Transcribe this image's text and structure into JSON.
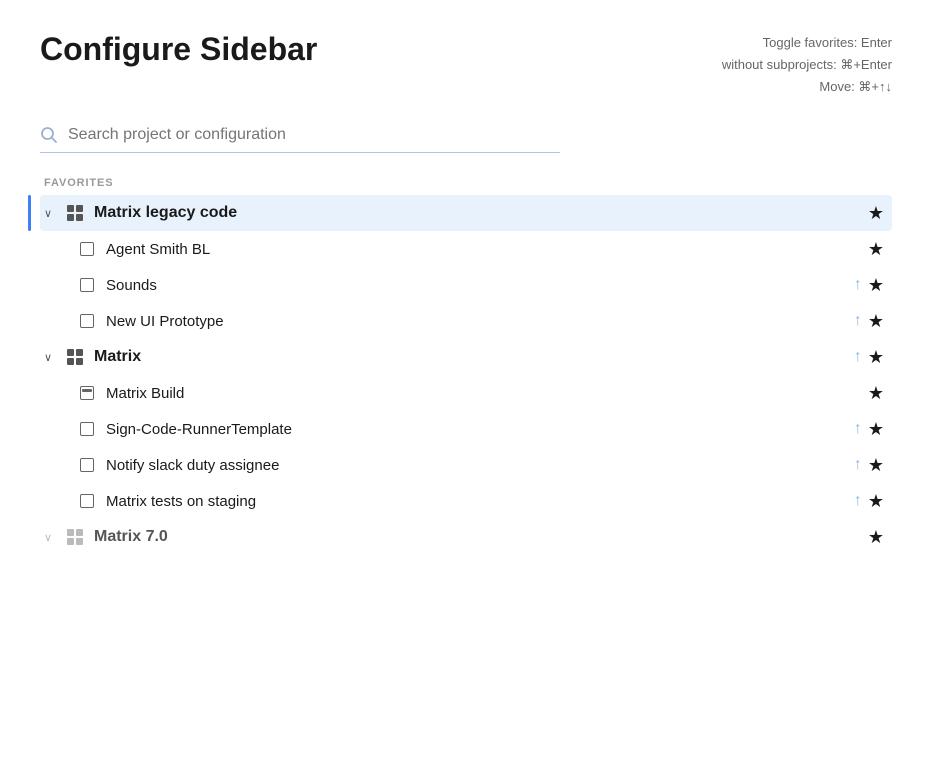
{
  "page": {
    "title": "Configure Sidebar",
    "shortcuts": {
      "line1": "Toggle favorites: Enter",
      "line2": "without subprojects: ⌘+Enter",
      "line3": "Move: ⌘+↑↓"
    }
  },
  "search": {
    "placeholder": "Search project or configuration"
  },
  "sections": [
    {
      "id": "favorites",
      "label": "FAVORITES",
      "items": [
        {
          "id": "matrix-legacy",
          "name": "Matrix legacy code",
          "type": "project",
          "indent": 0,
          "expanded": true,
          "highlighted": true,
          "hasArrow": false,
          "hasStar": true,
          "starFilled": true
        },
        {
          "id": "agent-smith-bl",
          "name": "Agent Smith BL",
          "type": "config",
          "indent": 1,
          "expanded": false,
          "highlighted": false,
          "hasArrow": false,
          "hasStar": true,
          "starFilled": true
        },
        {
          "id": "sounds",
          "name": "Sounds",
          "type": "config",
          "indent": 1,
          "expanded": false,
          "highlighted": false,
          "hasArrow": true,
          "hasStar": true,
          "starFilled": true
        },
        {
          "id": "new-ui-prototype",
          "name": "New UI Prototype",
          "type": "config",
          "indent": 1,
          "expanded": false,
          "highlighted": false,
          "hasArrow": true,
          "hasStar": true,
          "starFilled": true
        },
        {
          "id": "matrix",
          "name": "Matrix",
          "type": "project",
          "indent": 0,
          "expanded": true,
          "highlighted": false,
          "hasArrow": true,
          "hasStar": true,
          "starFilled": true
        },
        {
          "id": "matrix-build",
          "name": "Matrix Build",
          "type": "build",
          "indent": 1,
          "expanded": false,
          "highlighted": false,
          "hasArrow": false,
          "hasStar": true,
          "starFilled": true
        },
        {
          "id": "sign-code-runner",
          "name": "Sign-Code-RunnerTemplate",
          "type": "config",
          "indent": 1,
          "expanded": false,
          "highlighted": false,
          "hasArrow": true,
          "hasStar": true,
          "starFilled": true
        },
        {
          "id": "notify-slack",
          "name": "Notify slack duty assignee",
          "type": "config",
          "indent": 1,
          "expanded": false,
          "highlighted": false,
          "hasArrow": true,
          "hasStar": true,
          "starFilled": true
        },
        {
          "id": "matrix-tests-staging",
          "name": "Matrix tests on staging",
          "type": "config",
          "indent": 1,
          "expanded": false,
          "highlighted": false,
          "hasArrow": true,
          "hasStar": true,
          "starFilled": true
        },
        {
          "id": "matrix-7",
          "name": "Matrix 7.0",
          "type": "project",
          "indent": 0,
          "expanded": true,
          "highlighted": false,
          "hasArrow": false,
          "hasStar": true,
          "starFilled": true,
          "iconLight": true
        }
      ]
    }
  ]
}
